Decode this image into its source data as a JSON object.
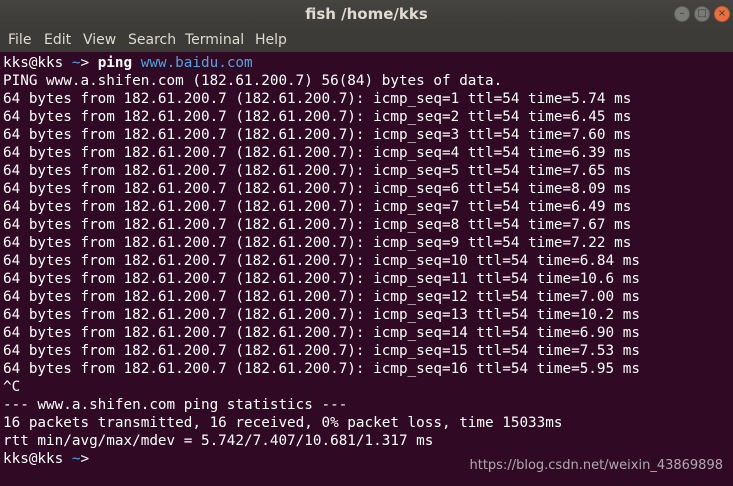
{
  "window": {
    "title": "fish  /home/kks",
    "controls": {
      "minimize": "–",
      "maximize": "□",
      "close": "×"
    }
  },
  "menu": [
    "File",
    "Edit",
    "View",
    "Search",
    "Terminal",
    "Help"
  ],
  "colors": {
    "background": "#300a24",
    "text": "#ffffff",
    "url": "#4fa3e0",
    "titlebar": "#3c3b37",
    "close": "#e86f3f"
  },
  "terminal": {
    "command": {
      "user_host": "kks@kks",
      "dir": "~",
      "arrow": "> ",
      "cmd": "ping",
      "arg": "www.baidu.com"
    },
    "header": "PING www.a.shifen.com (182.61.200.7) 56(84) bytes of data.",
    "replies": [
      "64 bytes from 182.61.200.7 (182.61.200.7): icmp_seq=1 ttl=54 time=5.74 ms",
      "64 bytes from 182.61.200.7 (182.61.200.7): icmp_seq=2 ttl=54 time=6.45 ms",
      "64 bytes from 182.61.200.7 (182.61.200.7): icmp_seq=3 ttl=54 time=7.60 ms",
      "64 bytes from 182.61.200.7 (182.61.200.7): icmp_seq=4 ttl=54 time=6.39 ms",
      "64 bytes from 182.61.200.7 (182.61.200.7): icmp_seq=5 ttl=54 time=7.65 ms",
      "64 bytes from 182.61.200.7 (182.61.200.7): icmp_seq=6 ttl=54 time=8.09 ms",
      "64 bytes from 182.61.200.7 (182.61.200.7): icmp_seq=7 ttl=54 time=6.49 ms",
      "64 bytes from 182.61.200.7 (182.61.200.7): icmp_seq=8 ttl=54 time=7.67 ms",
      "64 bytes from 182.61.200.7 (182.61.200.7): icmp_seq=9 ttl=54 time=7.22 ms",
      "64 bytes from 182.61.200.7 (182.61.200.7): icmp_seq=10 ttl=54 time=6.84 ms",
      "64 bytes from 182.61.200.7 (182.61.200.7): icmp_seq=11 ttl=54 time=10.6 ms",
      "64 bytes from 182.61.200.7 (182.61.200.7): icmp_seq=12 ttl=54 time=7.00 ms",
      "64 bytes from 182.61.200.7 (182.61.200.7): icmp_seq=13 ttl=54 time=10.2 ms",
      "64 bytes from 182.61.200.7 (182.61.200.7): icmp_seq=14 ttl=54 time=6.90 ms",
      "64 bytes from 182.61.200.7 (182.61.200.7): icmp_seq=15 ttl=54 time=7.53 ms",
      "64 bytes from 182.61.200.7 (182.61.200.7): icmp_seq=16 ttl=54 time=5.95 ms"
    ],
    "interrupt": "^C",
    "stats_header": "--- www.a.shifen.com ping statistics ---",
    "stats_packets": "16 packets transmitted, 16 received, 0% packet loss, time 15033ms",
    "stats_rtt": "rtt min/avg/max/mdev = 5.742/7.407/10.681/1.317 ms",
    "final_prompt": {
      "user_host": "kks@kks",
      "dir": "~",
      "arrow": "> "
    }
  },
  "watermark": "https://blog.csdn.net/weixin_43869898"
}
